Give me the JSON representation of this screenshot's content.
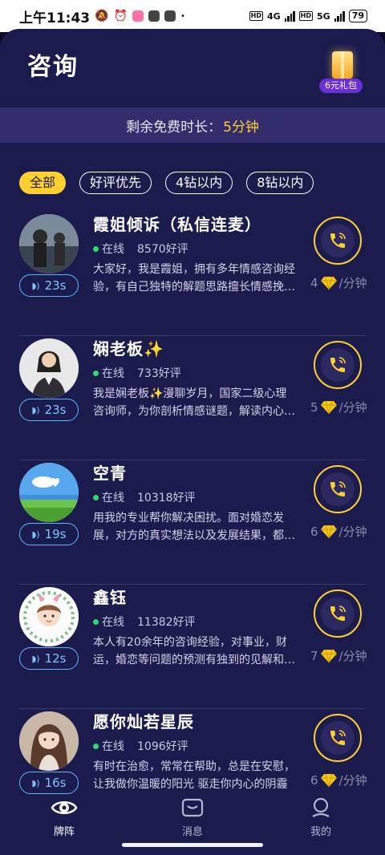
{
  "status_bar": {
    "time": "上午11:43",
    "net_left": "4G",
    "net_right": "5G",
    "hd": "HD",
    "battery": "79"
  },
  "header": {
    "title": "咨询",
    "gift_label": "6元礼包"
  },
  "free_time": {
    "label": "剩余免费时长：",
    "value": "5分钟"
  },
  "filters": [
    {
      "label": "全部",
      "active": true
    },
    {
      "label": "好评优先",
      "active": false
    },
    {
      "label": "4钻以内",
      "active": false
    },
    {
      "label": "8钻以内",
      "active": false
    }
  ],
  "online_label": "在线",
  "price_unit": "/分钟",
  "consultants": [
    {
      "name": "霞姐倾诉（私信连麦）",
      "reviews": "8570好评",
      "voice": "23s",
      "price": "4",
      "desc": "大家好，我是霞姐，拥有多年情感咨询经验，有自己独特的解题思路擅长情感挽回、婚姻危机处理"
    },
    {
      "name": "娴老板✨",
      "reviews": "733好评",
      "voice": "23s",
      "price": "5",
      "desc": "我是娴老板✨漫聊岁月，国家二级心理咨询师，为你剖析情感谜题，解读内心困惑"
    },
    {
      "name": "空青",
      "reviews": "10318好评",
      "voice": "19s",
      "price": "6",
      "desc": "用我的专业帮你解决困扰。面对婚恋发展，对方的真实想法以及发展结果，都可以为你解答"
    },
    {
      "name": "鑫钰",
      "reviews": "11382好评",
      "voice": "12s",
      "price": "7",
      "desc": "本人有20余年的咨询经验，对事业，财运，婚恋等问题的预测有独到的见解和分析"
    },
    {
      "name": "愿你灿若星辰",
      "reviews": "1096好评",
      "voice": "16s",
      "price": "6",
      "desc": "有时在治愈，常常在帮助，总是在安慰，让我做你温暖的阳光 驱走你内心的阴霾"
    }
  ],
  "tabbar": [
    {
      "label": "牌阵",
      "icon": "eye-icon",
      "active": true
    },
    {
      "label": "消息",
      "icon": "message-icon",
      "active": false
    },
    {
      "label": "我的",
      "icon": "profile-icon",
      "active": false
    }
  ],
  "colors": {
    "accent": "#ffd02f",
    "background": "#1c1b4e",
    "online": "#2fd873",
    "voice": "#5ab7ff"
  }
}
